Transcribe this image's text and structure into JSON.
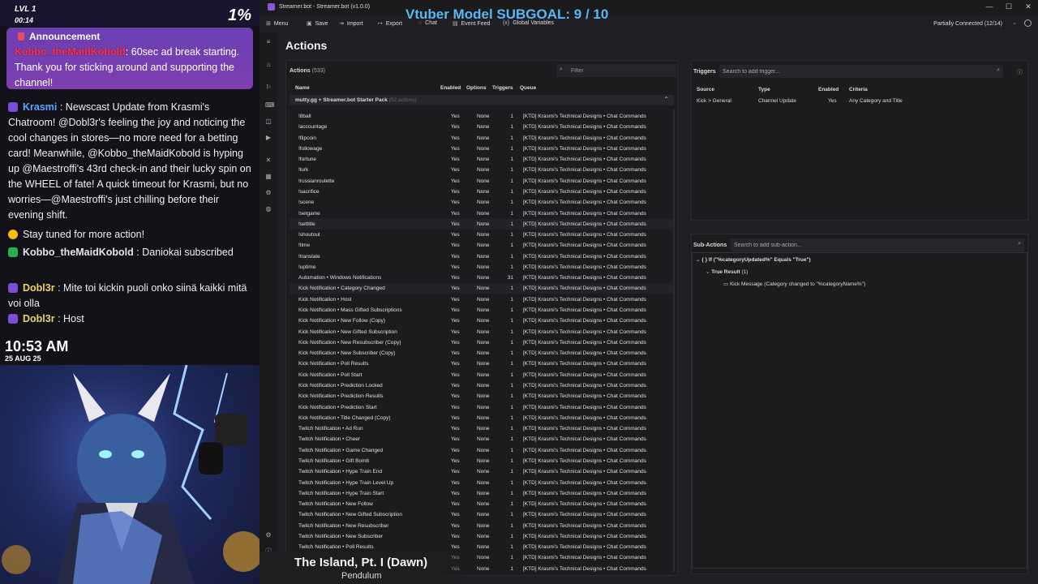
{
  "overlay": {
    "level": "LVL 1",
    "level_time": "00:14",
    "percent": "1%",
    "announcement": {
      "title": "Announcement",
      "user": "Kobbo_theMaidKobold",
      "text": ": 60sec ad break starting. Thank you for sticking around and supporting the channel!"
    },
    "chat": [
      {
        "user": "Krasmi",
        "user_color": "#58a6ff",
        "text": " : Newscast Update from Krasmi's Chatroom! @Dobl3r's feeling the joy and noticing the cool changes in stores—no more need for a betting card! Meanwhile, @Kobbo_theMaidKobold is hyping up @Maestroffi's 43rd check-in and their lucky spin on the WHEEL of fate! A quick timeout for Krasmi, but no worries—@Maestroffi's just chilling before their evening shift."
      },
      {
        "user": "",
        "user_color": "#ffffff",
        "text": "Stay tuned for more action!"
      },
      {
        "user": "Kobbo_theMaidKobold",
        "user_color": "#e6e6e6",
        "text": " : Daniokai subscribed"
      },
      {
        "user": "Dobl3r",
        "user_color": "#e8d36a",
        "text": " : Mite toi kickin puoli onko siinä kaikki mitä voi olla"
      },
      {
        "user": "Dobl3r",
        "user_color": "#e8d36a",
        "text": " : Host"
      }
    ],
    "clock": "10:53 AM",
    "date": "25 AUG 25"
  },
  "app": {
    "window_title": "Streamer.bot - Streamer.bot (v1.0.0)",
    "subgoal": "Vtuber Model SUBGOAL: 9 / 10",
    "menu": {
      "menu": "Menu",
      "save": "Save",
      "import": "Import",
      "export": "Export",
      "chat": "Chat",
      "event_feed": "Event Feed",
      "global_variables": "Global Variables"
    },
    "connection_status": "Partially Connected (12/14)",
    "page_title": "Actions"
  },
  "actions": {
    "header": "Actions",
    "count": "(533)",
    "filter_placeholder": "Filter",
    "columns": {
      "name": "Name",
      "enabled": "Enabled",
      "options": "Options",
      "triggers": "Triggers",
      "queue": "Queue"
    },
    "group": {
      "name": "mutty.gg + Streamer.bot Starter Pack",
      "sub": "(52 actions)"
    },
    "rows": [
      {
        "name": "!8ball",
        "enabled": "Yes",
        "options": "None",
        "triggers": "1",
        "queue": "[KTD] Krasmi's Technical Designs • Chat Commands"
      },
      {
        "name": "!accountage",
        "enabled": "Yes",
        "options": "None",
        "triggers": "1",
        "queue": "[KTD] Krasmi's Technical Designs • Chat Commands"
      },
      {
        "name": "!flipcoin",
        "enabled": "Yes",
        "options": "None",
        "triggers": "1",
        "queue": "[KTD] Krasmi's Technical Designs • Chat Commands"
      },
      {
        "name": "!followage",
        "enabled": "Yes",
        "options": "None",
        "triggers": "1",
        "queue": "[KTD] Krasmi's Technical Designs • Chat Commands"
      },
      {
        "name": "!fortune",
        "enabled": "Yes",
        "options": "None",
        "triggers": "1",
        "queue": "[KTD] Krasmi's Technical Designs • Chat Commands"
      },
      {
        "name": "!lurk",
        "enabled": "Yes",
        "options": "None",
        "triggers": "1",
        "queue": "[KTD] Krasmi's Technical Designs • Chat Commands"
      },
      {
        "name": "!russianroulette",
        "enabled": "Yes",
        "options": "None",
        "triggers": "1",
        "queue": "[KTD] Krasmi's Technical Designs • Chat Commands"
      },
      {
        "name": "!sacrifice",
        "enabled": "Yes",
        "options": "None",
        "triggers": "1",
        "queue": "[KTD] Krasmi's Technical Designs • Chat Commands"
      },
      {
        "name": "!scene",
        "enabled": "Yes",
        "options": "None",
        "triggers": "1",
        "queue": "[KTD] Krasmi's Technical Designs • Chat Commands"
      },
      {
        "name": "!setgame",
        "enabled": "Yes",
        "options": "None",
        "triggers": "1",
        "queue": "[KTD] Krasmi's Technical Designs • Chat Commands"
      },
      {
        "name": "!settitle",
        "enabled": "Yes",
        "options": "None",
        "triggers": "1",
        "queue": "[KTD] Krasmi's Technical Designs • Chat Commands"
      },
      {
        "name": "!shoutout",
        "enabled": "Yes",
        "options": "None",
        "triggers": "1",
        "queue": "[KTD] Krasmi's Technical Designs • Chat Commands"
      },
      {
        "name": "!time",
        "enabled": "Yes",
        "options": "None",
        "triggers": "1",
        "queue": "[KTD] Krasmi's Technical Designs • Chat Commands"
      },
      {
        "name": "!translate",
        "enabled": "Yes",
        "options": "None",
        "triggers": "1",
        "queue": "[KTD] Krasmi's Technical Designs • Chat Commands"
      },
      {
        "name": "!uptime",
        "enabled": "Yes",
        "options": "None",
        "triggers": "1",
        "queue": "[KTD] Krasmi's Technical Designs • Chat Commands"
      },
      {
        "name": "Automation • Windows Notifications",
        "enabled": "Yes",
        "options": "None",
        "triggers": "31",
        "queue": "[KTD] Krasmi's Technical Designs • Chat Commands"
      },
      {
        "name": "Kick Notification • Category Changed",
        "enabled": "Yes",
        "options": "None",
        "triggers": "1",
        "queue": "[KTD] Krasmi's Technical Designs • Chat Commands"
      },
      {
        "name": "Kick Notification • Host",
        "enabled": "Yes",
        "options": "None",
        "triggers": "1",
        "queue": "[KTD] Krasmi's Technical Designs • Chat Commands"
      },
      {
        "name": "Kick Notification • Mass Gifted Subscriptions",
        "enabled": "Yes",
        "options": "None",
        "triggers": "1",
        "queue": "[KTD] Krasmi's Technical Designs • Chat Commands"
      },
      {
        "name": "Kick Notification • New Follow (Copy)",
        "enabled": "Yes",
        "options": "None",
        "triggers": "1",
        "queue": "[KTD] Krasmi's Technical Designs • Chat Commands"
      },
      {
        "name": "Kick Notification • New Gifted Subscription",
        "enabled": "Yes",
        "options": "None",
        "triggers": "1",
        "queue": "[KTD] Krasmi's Technical Designs • Chat Commands"
      },
      {
        "name": "Kick Notification • New Resubscriber (Copy)",
        "enabled": "Yes",
        "options": "None",
        "triggers": "1",
        "queue": "[KTD] Krasmi's Technical Designs • Chat Commands"
      },
      {
        "name": "Kick Notification • New Subscriber (Copy)",
        "enabled": "Yes",
        "options": "None",
        "triggers": "1",
        "queue": "[KTD] Krasmi's Technical Designs • Chat Commands"
      },
      {
        "name": "Kick Notification • Poll Results",
        "enabled": "Yes",
        "options": "None",
        "triggers": "1",
        "queue": "[KTD] Krasmi's Technical Designs • Chat Commands"
      },
      {
        "name": "Kick Notification • Poll Start",
        "enabled": "Yes",
        "options": "None",
        "triggers": "1",
        "queue": "[KTD] Krasmi's Technical Designs • Chat Commands"
      },
      {
        "name": "Kick Notification • Prediction Locked",
        "enabled": "Yes",
        "options": "None",
        "triggers": "1",
        "queue": "[KTD] Krasmi's Technical Designs • Chat Commands"
      },
      {
        "name": "Kick Notification • Prediction Results",
        "enabled": "Yes",
        "options": "None",
        "triggers": "1",
        "queue": "[KTD] Krasmi's Technical Designs • Chat Commands"
      },
      {
        "name": "Kick Notification • Prediction Start",
        "enabled": "Yes",
        "options": "None",
        "triggers": "1",
        "queue": "[KTD] Krasmi's Technical Designs • Chat Commands"
      },
      {
        "name": "Kick Notification • Title Changed (Copy)",
        "enabled": "Yes",
        "options": "None",
        "triggers": "1",
        "queue": "[KTD] Krasmi's Technical Designs • Chat Commands"
      },
      {
        "name": "Twitch Notification • Ad Run",
        "enabled": "Yes",
        "options": "None",
        "triggers": "1",
        "queue": "[KTD] Krasmi's Technical Designs • Chat Commands"
      },
      {
        "name": "Twitch Notification • Cheer",
        "enabled": "Yes",
        "options": "None",
        "triggers": "1",
        "queue": "[KTD] Krasmi's Technical Designs • Chat Commands"
      },
      {
        "name": "Twitch Notification • Game Changed",
        "enabled": "Yes",
        "options": "None",
        "triggers": "1",
        "queue": "[KTD] Krasmi's Technical Designs • Chat Commands"
      },
      {
        "name": "Twitch Notification • Gift Bomb",
        "enabled": "Yes",
        "options": "None",
        "triggers": "1",
        "queue": "[KTD] Krasmi's Technical Designs • Chat Commands"
      },
      {
        "name": "Twitch Notification • Hype Train End",
        "enabled": "Yes",
        "options": "None",
        "triggers": "1",
        "queue": "[KTD] Krasmi's Technical Designs • Chat Commands"
      },
      {
        "name": "Twitch Notification • Hype Train Level Up",
        "enabled": "Yes",
        "options": "None",
        "triggers": "1",
        "queue": "[KTD] Krasmi's Technical Designs • Chat Commands"
      },
      {
        "name": "Twitch Notification • Hype Train Start",
        "enabled": "Yes",
        "options": "None",
        "triggers": "1",
        "queue": "[KTD] Krasmi's Technical Designs • Chat Commands"
      },
      {
        "name": "Twitch Notification • New Follow",
        "enabled": "Yes",
        "options": "None",
        "triggers": "1",
        "queue": "[KTD] Krasmi's Technical Designs • Chat Commands"
      },
      {
        "name": "Twitch Notification • New Gifted Subscription",
        "enabled": "Yes",
        "options": "None",
        "triggers": "1",
        "queue": "[KTD] Krasmi's Technical Designs • Chat Commands"
      },
      {
        "name": "Twitch Notification • New Resubscriber",
        "enabled": "Yes",
        "options": "None",
        "triggers": "1",
        "queue": "[KTD] Krasmi's Technical Designs • Chat Commands"
      },
      {
        "name": "Twitch Notification • New Subscriber",
        "enabled": "Yes",
        "options": "None",
        "triggers": "1",
        "queue": "[KTD] Krasmi's Technical Designs • Chat Commands"
      },
      {
        "name": "Twitch Notification • Poll Results",
        "enabled": "Yes",
        "options": "None",
        "triggers": "1",
        "queue": "[KTD] Krasmi's Technical Designs • Chat Commands"
      },
      {
        "name": "",
        "enabled": "Yes",
        "options": "None",
        "triggers": "1",
        "queue": "[KTD] Krasmi's Technical Designs • Chat Commands"
      },
      {
        "name": "",
        "enabled": "Yes",
        "options": "None",
        "triggers": "1",
        "queue": "[KTD] Krasmi's Technical Designs • Chat Commands"
      }
    ]
  },
  "triggers": {
    "header": "Triggers",
    "search_placeholder": "Search to add trigger...",
    "columns": {
      "source": "Source",
      "type": "Type",
      "enabled": "Enabled",
      "criteria": "Criteria"
    },
    "rows": [
      {
        "source": "Kick > General",
        "type": "Channel Update",
        "enabled": "Yes",
        "criteria": "Any Category and Title"
      }
    ]
  },
  "subactions": {
    "header": "Sub-Actions",
    "search_placeholder": "Search to add sub-action...",
    "if_node": "{ } If (\"%categoryUpdated%\" Equals \"True\")",
    "true_result": "True Result",
    "true_count": "(1)",
    "kick_message": "Kick Message (Category changed to \"%categoryName%\")"
  },
  "song": {
    "title": "The Island, Pt. I (Dawn)",
    "artist": "Pendulum"
  },
  "colors": {
    "accent_blue": "#58b8f5",
    "announcement_purple": "#7d3fb0",
    "app_bg": "#202024"
  }
}
